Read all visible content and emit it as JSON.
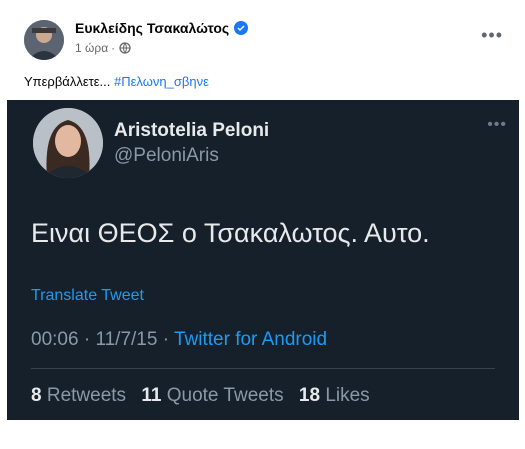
{
  "post": {
    "author_name": "Ευκλείδης Τσακαλώτος",
    "timestamp": "1 ώρα",
    "separator": "·",
    "text_prefix": "Υπερβάλλετε...",
    "hashtag": "#Πελωνη_σβηνε",
    "more_label": "•••"
  },
  "tweet": {
    "name": "Aristotelia Peloni",
    "handle": "@PeloniAris",
    "more_label": "•••",
    "text": "Ειναι ΘΕΟΣ ο Τσακαλωτος. Αυτο.",
    "translate_label": "Translate Tweet",
    "time": "00:06",
    "date": "11/7/15",
    "separator": "·",
    "source": "Twitter for Android",
    "stats": {
      "retweets_count": "8",
      "retweets_label": "Retweets",
      "quotes_count": "11",
      "quotes_label": "Quote Tweets",
      "likes_count": "18",
      "likes_label": "Likes"
    }
  },
  "colors": {
    "fb_blue": "#1877f2",
    "twitter_bg": "#15202b",
    "twitter_blue": "#1d9bf0"
  }
}
